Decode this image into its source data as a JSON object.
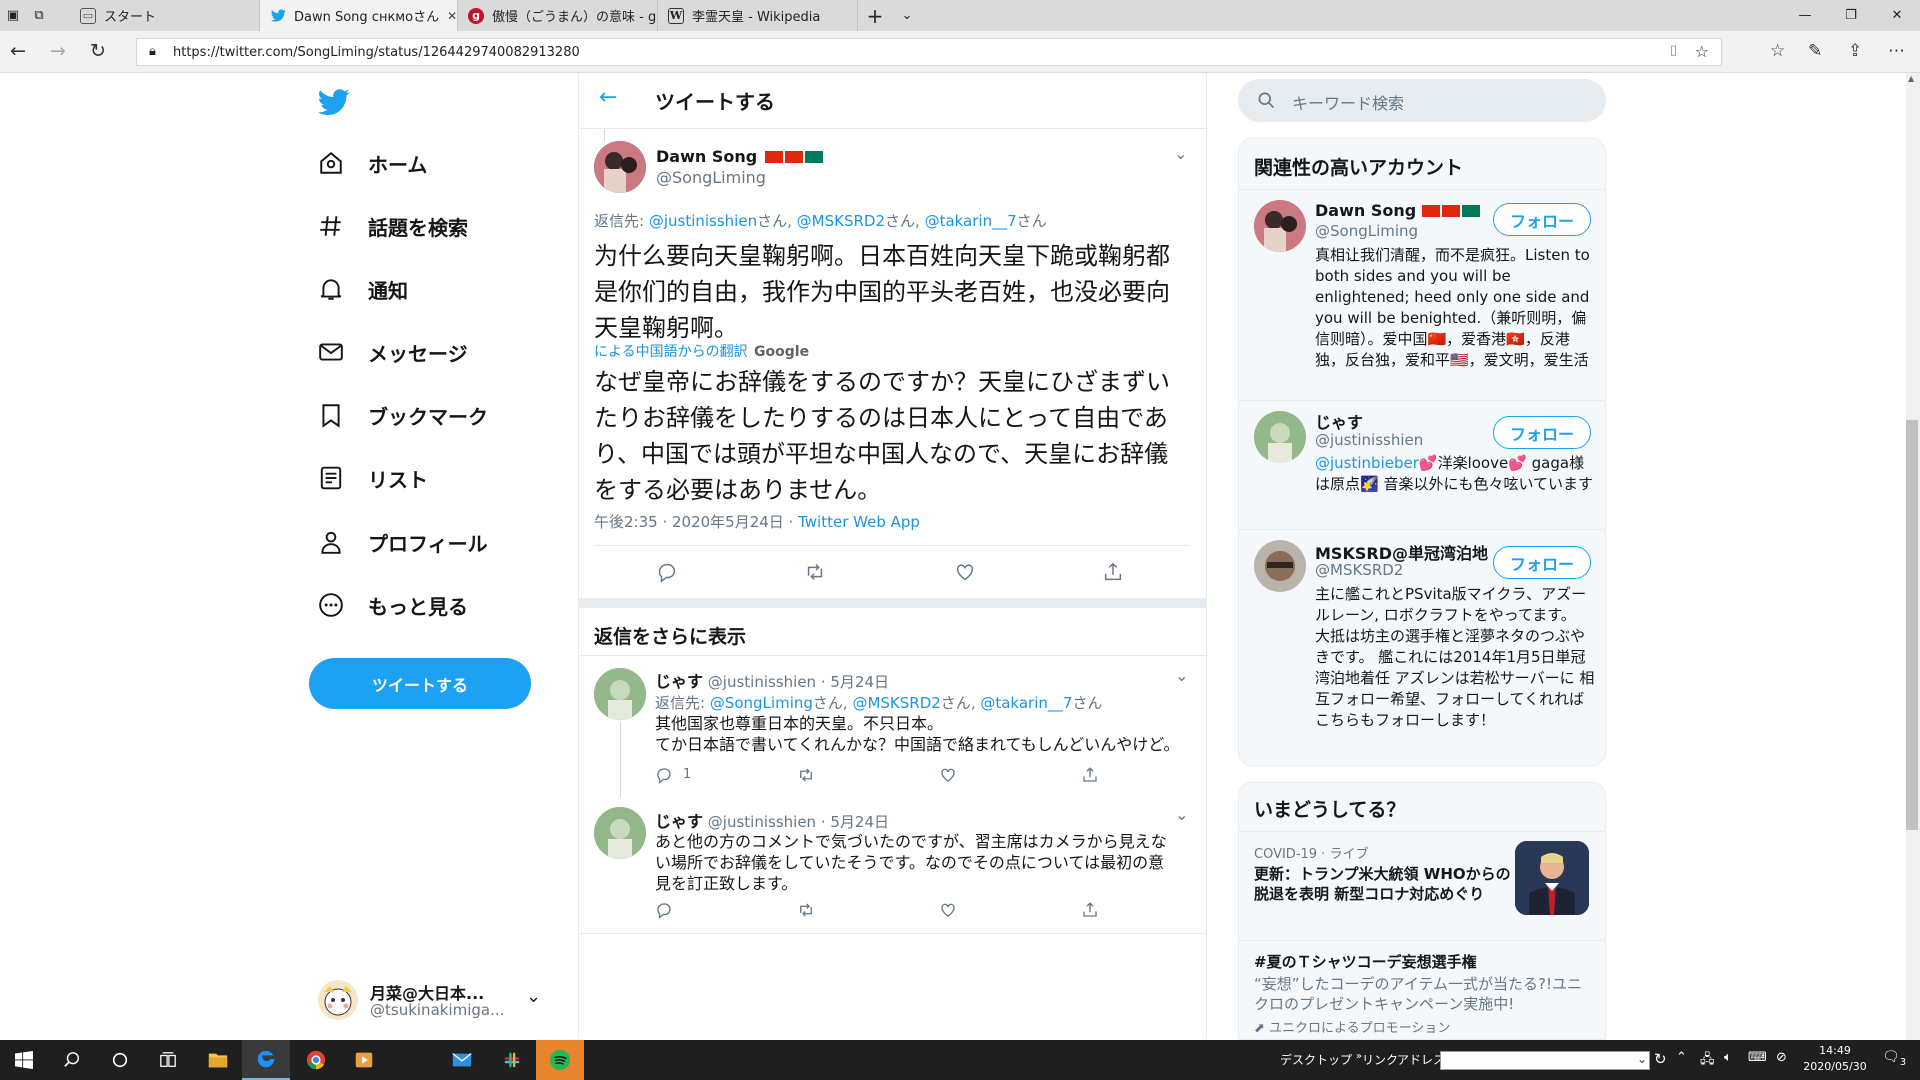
{
  "browser": {
    "tabs": [
      {
        "label": "スタート",
        "active": false
      },
      {
        "label": "Dawn Song снкмоさん",
        "active": true
      },
      {
        "label": "傲慢（ごうまん）の意味 - goo",
        "active": false
      },
      {
        "label": "李霊天皇 - Wikipedia",
        "active": false
      }
    ],
    "url": "https://twitter.com/SongLiming/status/1264429740082913280"
  },
  "sidebar": {
    "items": [
      {
        "label": "ホーム",
        "icon": "home-icon"
      },
      {
        "label": "話題を検索",
        "icon": "hashtag-icon"
      },
      {
        "label": "通知",
        "icon": "bell-icon"
      },
      {
        "label": "メッセージ",
        "icon": "mail-icon"
      },
      {
        "label": "ブックマーク",
        "icon": "bookmark-icon"
      },
      {
        "label": "リスト",
        "icon": "list-icon"
      },
      {
        "label": "プロフィール",
        "icon": "profile-icon"
      },
      {
        "label": "もっと見る",
        "icon": "more-icon"
      }
    ],
    "tweet_button": "ツイートする",
    "account": {
      "name": "月菜@大日本...",
      "handle": "@tsukinakimiga..."
    }
  },
  "main": {
    "header_title": "ツイートする",
    "tweet": {
      "name": "Dawn Song",
      "handle": "@SongLiming",
      "reply_prefix": "返信先: ",
      "reply_to_1": "@justinisshien",
      "reply_to_2": "@MSKSRD2",
      "reply_to_3": "@takarin__7",
      "san": "さん",
      "comma": ", ",
      "text": "为什么要向天皇鞠躬啊。日本百姓向天皇下跪或鞠躬都是你们的自由，我作为中国的平头老百姓，也没必要向天皇鞠躬啊。",
      "translation_label": "による中国語からの翻訳",
      "translation_provider": "Google",
      "translated_text": "なぜ皇帝にお辞儀をするのですか？天皇にひざまずいたりお辞儀をしたりするのは日本人にとって自由であり、中国では頭が平坦な中国人なので、天皇にお辞儀をする必要はありません。",
      "timestamp": "午後2:35 · 2020年5月24日 · ",
      "source": "Twitter Web App"
    },
    "more_replies_label": "返信をさらに表示",
    "replies": [
      {
        "name": "じゃす",
        "handle": "@justinisshien",
        "date": "· 5月24日",
        "reply_prefix": "返信先: ",
        "reply_to_1": "@SongLiming",
        "reply_to_2": "@MSKSRD2",
        "reply_to_3": "@takarin__7",
        "line1": "其他国家也尊重日本的天皇。不只日本。",
        "line2": "てか日本語で書いてくれんかな？中国語で絡まれてもしんどいんやけど。",
        "reply_count": "1"
      },
      {
        "name": "じゃす",
        "handle": "@justinisshien",
        "date": "· 5月24日",
        "text": "あと他の方のコメントで気づいたのですが、習主席はカメラから見えない場所でお辞儀をしていたそうです。なのでその点については最初の意見を訂正致します。"
      }
    ]
  },
  "right": {
    "search_placeholder": "キーワード検索",
    "relevant_title": "関連性の高いアカウント",
    "follow_label": "フォロー",
    "accounts": [
      {
        "name": "Dawn Song",
        "handle": "@SongLiming",
        "bio": "真相让我们清醒，而不是疯狂。Listen to both sides and you will be enlightened; heed only one side and you will be benighted.（兼听则明，偏信则暗）。爱中国🇨🇳，爱香港🇭🇰，反港独，反台独，爱和平🇺🇸，爱文明，爱生活"
      },
      {
        "name": "じゃす",
        "handle": "@justinisshien",
        "bio_link": "@justinbieber",
        "bio": "💕洋楽loove💕 gaga様は原点🌠 音楽以外にも色々呟いています"
      },
      {
        "name": "MSKSRD@単冠湾泊地",
        "handle": "@MSKSRD2",
        "bio": "主に艦これとPSvita版マイクラ、アズールレーン, ロボクラフトをやってます。 大抵は坊主の選手権と淫夢ネタのつぶやきです。 艦これには2014年1月5日単冠湾泊地着任 アズレンは若松サーバーに 相互フォロー希望、フォローしてくれればこちらもフォローします！"
      }
    ],
    "trends_title": "いまどうしてる？",
    "trend1": {
      "category": "COVID-19 · ライブ",
      "headline": "更新：トランプ米大統領 WHOからの脱退を表明 新型コロナ対応めぐり"
    },
    "trend2": {
      "tag": "#夏のＴシャツコーデ妄想選手権",
      "desc": "“妄想”したコーデのアイテム一式が当たる?!ユニクロのプレゼントキャンペーン実施中!",
      "promo": "ユニクロによるプロモーション"
    }
  },
  "taskbar": {
    "desktop": "デスクトップ",
    "chevrons": "»",
    "links": "リンク",
    "address": "アドレス",
    "time": "14:49",
    "date": "2020/05/30",
    "notifications": "3"
  },
  "colors": {
    "accent": "#1da1f2",
    "link": "#1b95e0",
    "gray": "#657786"
  }
}
